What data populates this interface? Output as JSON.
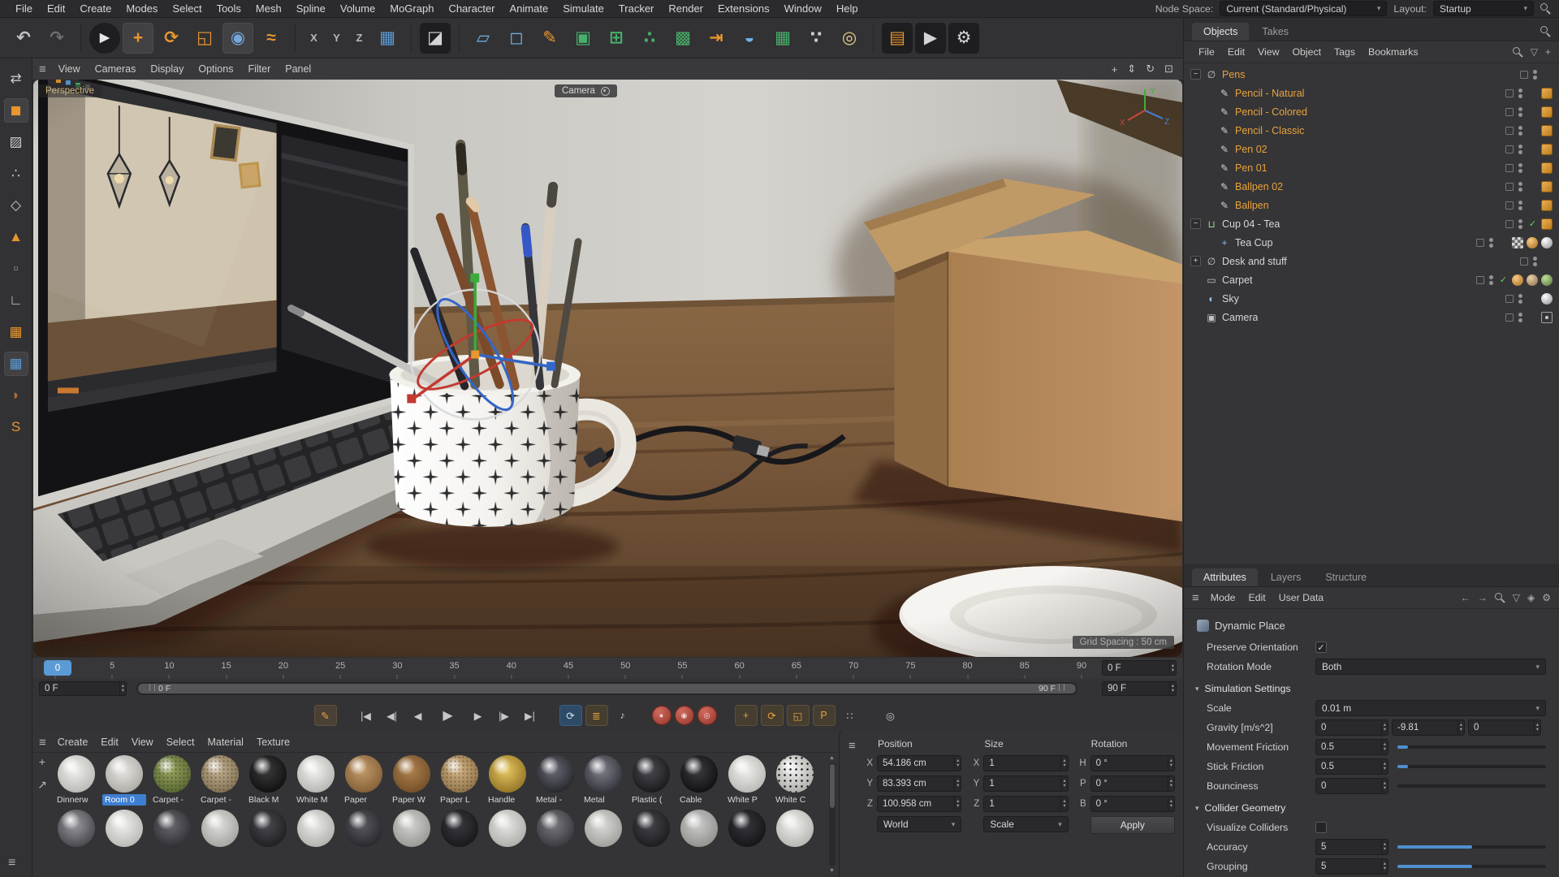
{
  "colors": {
    "accent_orange": "#e8962e",
    "selected_text": "#e8a23c",
    "accent_blue": "#5b9bd5",
    "selection_bg": "#3f7fd2",
    "ui_dark": "#333335"
  },
  "icons": {
    "burger": "≡",
    "chevron": "▾",
    "spin_up": "▴",
    "spin_down": "▾",
    "tick_up": "▲",
    "tick_down": "▼",
    "check": "✓",
    "filter": "▽",
    "back": "←",
    "forward": "→",
    "up": "↑",
    "plus": "+",
    "arrow_ne": "↗",
    "gear": "⚙",
    "lock": "◈",
    "dolly": "⇕",
    "orbit": "↻",
    "maximize": "⊡",
    "pan": "+",
    "section_open": "▾"
  },
  "menu_bar": {
    "items": [
      "File",
      "Edit",
      "Create",
      "Modes",
      "Select",
      "Tools",
      "Mesh",
      "Spline",
      "Volume",
      "MoGraph",
      "Character",
      "Animate",
      "Simulate",
      "Tracker",
      "Render",
      "Extensions",
      "Window",
      "Help"
    ],
    "node_space_label": "Node Space:",
    "node_space_value": "Current (Standard/Physical)",
    "layout_label": "Layout:",
    "layout_value": "Startup"
  },
  "toolbar": {
    "buttons": [
      {
        "name": "undo-icon",
        "glyph": "↶",
        "color": "#c2c2c4"
      },
      {
        "name": "redo-icon",
        "glyph": "↷",
        "color": "#6e6e72"
      },
      {
        "sep": true
      },
      {
        "name": "live-selection-tool",
        "glyph": "►",
        "color": "#e6e6e8",
        "dark": true,
        "round": true
      },
      {
        "name": "move-tool",
        "glyph": "+",
        "color": "#e8962e",
        "active": true
      },
      {
        "name": "rotate-tool",
        "glyph": "⟳",
        "color": "#e8962e"
      },
      {
        "name": "scale-tool",
        "glyph": "◱",
        "color": "#e8962e"
      },
      {
        "name": "dynamic-place-tool",
        "glyph": "◉",
        "color": "#74a8dc",
        "active": true
      },
      {
        "name": "simulate-tool",
        "glyph": "≈",
        "color": "#e8962e"
      },
      {
        "sep": true
      },
      {
        "name": "axis-lock-x-button",
        "glyph": "X",
        "color": "#b8b8ba",
        "small": true
      },
      {
        "name": "axis-lock-y-button",
        "glyph": "Y",
        "color": "#b8b8ba",
        "small": true
      },
      {
        "name": "axis-lock-z-button",
        "glyph": "Z",
        "color": "#b8b8ba",
        "small": true
      },
      {
        "name": "workplane-button",
        "glyph": "▦",
        "color": "#5b9bd5"
      },
      {
        "sep": true
      },
      {
        "name": "render-view-button",
        "glyph": "◪",
        "color": "#d4d4d6",
        "dark": true
      },
      {
        "sep": true
      },
      {
        "name": "floor-object-button",
        "glyph": "▱",
        "color": "#6fb3e8"
      },
      {
        "name": "cube-primitive-button",
        "glyph": "◻",
        "color": "#6fb3e8"
      },
      {
        "name": "pen-spline-button",
        "glyph": "✎",
        "color": "#e8962e"
      },
      {
        "name": "cloner-object-button",
        "glyph": "▣",
        "color": "#47b06a"
      },
      {
        "name": "symmetry-object-button",
        "glyph": "⊞",
        "color": "#47b06a"
      },
      {
        "name": "array-object-button",
        "glyph": "∴",
        "color": "#47b06a"
      },
      {
        "name": "fracture-object-button",
        "glyph": "▩",
        "color": "#47b06a"
      },
      {
        "name": "measure-object-button",
        "glyph": "⇥",
        "color": "#e8962e"
      },
      {
        "name": "cloth-object-button",
        "glyph": "◒",
        "color": "#6fb3e8"
      },
      {
        "name": "plane-object-button",
        "glyph": "▦",
        "color": "#47b06a"
      },
      {
        "name": "particles-object-button",
        "glyph": "∵",
        "color": "#d0d0d2"
      },
      {
        "name": "light-object-button",
        "glyph": "◎",
        "color": "#e8d08a"
      },
      {
        "sep": true
      },
      {
        "name": "nodes-palette-button",
        "glyph": "▤",
        "color": "#e8962e",
        "dark": true
      },
      {
        "name": "render-play-button",
        "glyph": "▶",
        "color": "#d4d4d6",
        "dark": true
      },
      {
        "name": "render-settings-button",
        "glyph": "⚙",
        "color": "#d4d4d6",
        "dark": true
      }
    ]
  },
  "sidebar": {
    "buttons": [
      {
        "name": "make-editable-button",
        "glyph": "⇄",
        "color": "#c8c8ca"
      },
      {
        "name": "model-mode-button",
        "glyph": "◼",
        "color": "#e8962e",
        "active": true
      },
      {
        "name": "texture-mode-button",
        "glyph": "▨",
        "color": "#c8c8ca"
      },
      {
        "name": "points-mode-button",
        "glyph": "∴",
        "color": "#c8c8ca"
      },
      {
        "name": "edges-mode-button",
        "glyph": "◇",
        "color": "#c8c8ca"
      },
      {
        "name": "polygons-mode-button",
        "glyph": "▲",
        "color": "#e8962e"
      },
      {
        "name": "tweak-mode-button",
        "glyph": "▫",
        "color": "#9a9a9c"
      },
      {
        "name": "enable-axis-button",
        "glyph": "∟",
        "color": "#c8c8ca"
      },
      {
        "name": "workplane-mode-button",
        "glyph": "▦",
        "color": "#e8962e"
      },
      {
        "name": "snap-settings-button",
        "glyph": "▦",
        "color": "#5b9bd5",
        "active": true
      },
      {
        "name": "paint-tool-button",
        "glyph": "◗",
        "color": "#b06a3a"
      },
      {
        "name": "substance-button",
        "glyph": "S",
        "color": "#e8962e"
      }
    ]
  },
  "viewport": {
    "menu": [
      "View",
      "Cameras",
      "Display",
      "Options",
      "Filter",
      "Panel"
    ],
    "right_buttons": [
      {
        "name": "camera-pan-icon",
        "glyph": "+"
      },
      {
        "name": "camera-dolly-icon",
        "glyph": "⇕"
      },
      {
        "name": "camera-orbit-icon",
        "glyph": "↻"
      },
      {
        "name": "toggle-view-icon",
        "glyph": "⊡"
      }
    ],
    "view_label": "Perspective",
    "camera_badge": "Camera",
    "grid_spacing_label": "Grid Spacing : 50 cm",
    "axis_labels": {
      "x": "X",
      "y": "Y",
      "z": "Z"
    }
  },
  "object_manager": {
    "tabs": [
      {
        "label": "Objects",
        "active": true
      },
      {
        "label": "Takes",
        "active": false
      }
    ],
    "menu": [
      "File",
      "Edit",
      "View",
      "Object",
      "Tags",
      "Bookmarks"
    ],
    "right_icons": [
      {
        "name": "search-icon",
        "glyph": "css-mag"
      },
      {
        "name": "filter-icon",
        "glyph": "▽"
      },
      {
        "name": "bookmark-add-icon",
        "glyph": "+"
      }
    ],
    "icon_map": {
      "null": {
        "glyph": "∅",
        "color": "#c2c2c4"
      },
      "pencil": {
        "glyph": "✎",
        "color": "#d2d2d4"
      },
      "cup": {
        "glyph": "⊔",
        "color": "#9fd49f"
      },
      "axis": {
        "glyph": "+",
        "color": "#8fb8e8"
      },
      "plane": {
        "glyph": "▭",
        "color": "#c2c2c4"
      },
      "sky": {
        "glyph": "◐",
        "color": "#9ec7e8"
      },
      "camera": {
        "glyph": "▣",
        "color": "#c2c2c4"
      }
    },
    "tree": [
      {
        "label": "Pens",
        "depth": 0,
        "icon": "null",
        "selected": true,
        "expander": "open",
        "check": false,
        "tags": []
      },
      {
        "label": "Pencil - Natural",
        "depth": 1,
        "icon": "pencil",
        "selected": true,
        "expander": "none",
        "check": false,
        "tags": [
          "mat"
        ]
      },
      {
        "label": "Pencil - Colored",
        "depth": 1,
        "icon": "pencil",
        "selected": true,
        "expander": "none",
        "check": false,
        "tags": [
          "mat"
        ]
      },
      {
        "label": "Pencil - Classic",
        "depth": 1,
        "icon": "pencil",
        "selected": true,
        "expander": "none",
        "check": false,
        "tags": [
          "mat"
        ]
      },
      {
        "label": "Pen 02",
        "depth": 1,
        "icon": "pencil",
        "selected": true,
        "expander": "none",
        "check": false,
        "tags": [
          "mat"
        ]
      },
      {
        "label": "Pen 01",
        "depth": 1,
        "icon": "pencil",
        "selected": true,
        "expander": "none",
        "check": false,
        "tags": [
          "mat"
        ]
      },
      {
        "label": "Ballpen 02",
        "depth": 1,
        "icon": "pencil",
        "selected": true,
        "expander": "none",
        "check": false,
        "tags": [
          "mat"
        ]
      },
      {
        "label": "Ballpen",
        "depth": 1,
        "icon": "pencil",
        "selected": true,
        "expander": "none",
        "check": false,
        "tags": [
          "mat"
        ]
      },
      {
        "label": "Cup 04 - Tea",
        "depth": 0,
        "icon": "cup",
        "selected": false,
        "expander": "open",
        "check": true,
        "tags": [
          "mat"
        ]
      },
      {
        "label": "Tea Cup",
        "depth": 1,
        "icon": "axis",
        "selected": false,
        "expander": "none",
        "check": false,
        "tags": [
          "checker",
          "dot-orange",
          "sphere-gray"
        ]
      },
      {
        "label": "Desk and stuff",
        "depth": 0,
        "icon": "null",
        "selected": false,
        "expander": "closed",
        "check": false,
        "tags": []
      },
      {
        "label": "Carpet",
        "depth": 0,
        "icon": "plane",
        "selected": false,
        "expander": "none",
        "check": true,
        "tags": [
          "dot-orange",
          "sphere-tan",
          "sphere-green"
        ]
      },
      {
        "label": "Sky",
        "depth": 0,
        "icon": "sky",
        "selected": false,
        "expander": "none",
        "check": false,
        "tags": [
          "sphere-gray"
        ]
      },
      {
        "label": "Camera",
        "depth": 0,
        "icon": "camera",
        "selected": false,
        "expander": "none",
        "check": false,
        "tags": [
          "target"
        ]
      }
    ]
  },
  "attributes": {
    "tabs": [
      {
        "label": "Attributes",
        "active": true
      },
      {
        "label": "Layers",
        "active": false
      },
      {
        "label": "Structure",
        "active": false
      }
    ],
    "menu": [
      "Mode",
      "Edit",
      "User Data"
    ],
    "right_icons": [
      {
        "name": "history-back-icon",
        "glyph": "←"
      },
      {
        "name": "history-forward-icon",
        "glyph": "→"
      },
      {
        "name": "search-icon",
        "glyph": "css-mag"
      },
      {
        "name": "filter-icon",
        "glyph": "▽"
      },
      {
        "name": "lock-icon",
        "glyph": "◈"
      },
      {
        "name": "settings-gear-icon",
        "glyph": "⚙"
      }
    ],
    "object_title": "Dynamic Place",
    "rows": [
      {
        "type": "check",
        "label": "Preserve Orientation",
        "checked": true
      },
      {
        "type": "dropdown",
        "label": "Rotation Mode",
        "value": "Both"
      },
      {
        "type": "section",
        "label": "Simulation Settings"
      },
      {
        "type": "dropdown",
        "label": "Scale",
        "value": "0.01 m"
      },
      {
        "type": "triple",
        "label": "Gravity [m/s^2]",
        "values": [
          "0",
          "-9.81",
          "0"
        ]
      },
      {
        "type": "slider",
        "label": "Movement Friction",
        "value": "0.5",
        "fill": 7
      },
      {
        "type": "slider",
        "label": "Stick Friction",
        "value": "0.5",
        "fill": 7
      },
      {
        "type": "slider",
        "label": "Bounciness",
        "value": "0",
        "fill": 0
      },
      {
        "type": "section",
        "label": "Collider Geometry"
      },
      {
        "type": "check",
        "label": "Visualize Colliders",
        "checked": false
      },
      {
        "type": "slider",
        "label": "Accuracy",
        "value": "5",
        "fill": 50
      },
      {
        "type": "slider",
        "label": "Grouping",
        "value": "5",
        "fill": 50
      }
    ]
  },
  "timeline": {
    "ticks": [
      "0",
      "5",
      "10",
      "15",
      "20",
      "25",
      "30",
      "35",
      "40",
      "45",
      "50",
      "55",
      "60",
      "65",
      "70",
      "75",
      "80",
      "85",
      "90"
    ],
    "playhead": "0",
    "current_field": "0 F",
    "range_start_field": "0 F",
    "range_end_field": "90 F",
    "bar_start_label": "0 F",
    "bar_end_label": "90 F"
  },
  "playback": {
    "buttons": [
      {
        "name": "animation-palette-button",
        "glyph": "✎",
        "kind": "obg"
      },
      {
        "gap": true
      },
      {
        "name": "go-to-start-button",
        "glyph": "|◀"
      },
      {
        "name": "previous-key-button",
        "glyph": "◀|"
      },
      {
        "name": "previous-frame-button",
        "glyph": "◀"
      },
      {
        "name": "play-button",
        "glyph": "▶",
        "kind": "big"
      },
      {
        "name": "next-frame-button",
        "glyph": "▶"
      },
      {
        "name": "next-key-button",
        "glyph": "|▶"
      },
      {
        "name": "go-to-end-button",
        "glyph": "▶|"
      },
      {
        "gap": true
      },
      {
        "name": "loop-mode-button",
        "glyph": "⟳",
        "kind": "blue"
      },
      {
        "name": "keyframe-track-button",
        "glyph": "≣",
        "kind": "orange"
      },
      {
        "name": "sound-mute-button",
        "glyph": "♪"
      },
      {
        "gap": true
      },
      {
        "name": "record-keyframe-button",
        "glyph": "●",
        "kind": "red"
      },
      {
        "name": "autokey-toggle-button",
        "glyph": "◉",
        "kind": "red"
      },
      {
        "name": "keyframe-selection-button",
        "glyph": "◎",
        "kind": "red"
      },
      {
        "gap": true
      },
      {
        "name": "record-position-button",
        "glyph": "+",
        "kind": "orange"
      },
      {
        "name": "record-rotation-button",
        "glyph": "⟳",
        "kind": "orange"
      },
      {
        "name": "record-scale-button",
        "glyph": "◱",
        "kind": "orange"
      },
      {
        "name": "record-parameter-button",
        "glyph": "P",
        "kind": "orange"
      },
      {
        "name": "record-pla-button",
        "glyph": "∷"
      },
      {
        "gap": true
      },
      {
        "name": "solo-animation-button",
        "glyph": "◎"
      }
    ]
  },
  "materials": {
    "menu": [
      "Create",
      "Edit",
      "View",
      "Select",
      "Material",
      "Texture"
    ],
    "items": [
      {
        "name": "Dinnerw",
        "c1": "#f0f0ee",
        "c2": "#b0b0ac"
      },
      {
        "name": "Room 0",
        "c1": "#e8e6e2",
        "c2": "#a4a29c",
        "selected": true
      },
      {
        "name": "Carpet -",
        "c1": "#97a45e",
        "c2": "#50602e",
        "kind": "speckle"
      },
      {
        "name": "Carpet -",
        "c1": "#c2b190",
        "c2": "#7a6a4c",
        "kind": "speckle"
      },
      {
        "name": "Black M",
        "c1": "#3c3c3e",
        "c2": "#0a0a0a"
      },
      {
        "name": "White M",
        "c1": "#f2f2f0",
        "c2": "#acaca8"
      },
      {
        "name": "Paper",
        "c1": "#c49a68",
        "c2": "#7a5830"
      },
      {
        "name": "Paper W",
        "c1": "#b0824e",
        "c2": "#6a4822"
      },
      {
        "name": "Paper L",
        "c1": "#d4b484",
        "c2": "#866a42",
        "kind": "speckle"
      },
      {
        "name": "Handle",
        "c1": "#e8c860",
        "c2": "#86681e"
      },
      {
        "name": "Metal -",
        "c1": "#6a6a74",
        "c2": "#1c1c22"
      },
      {
        "name": "Metal",
        "c1": "#80808a",
        "c2": "#282830"
      },
      {
        "name": "Plastic (",
        "c1": "#4a4a50",
        "c2": "#121216"
      },
      {
        "name": "Cable",
        "c1": "#3c3c40",
        "c2": "#0a0a0c"
      },
      {
        "name": "White P",
        "c1": "#f0f0ee",
        "c2": "#b0b0ac"
      },
      {
        "name": "White C",
        "c1": "#ececea",
        "c2": "#a4a4a0",
        "kind": "dots"
      }
    ],
    "row2": [
      [
        "#9a9aa0",
        "#3a3a40"
      ],
      [
        "#f0f0ee",
        "#b0b0ac"
      ],
      [
        "#6a6a70",
        "#26262c"
      ],
      [
        "#e0e0de",
        "#9a9a96"
      ],
      [
        "#4a4a50",
        "#18181c"
      ],
      [
        "#ececea",
        "#a8a8a4"
      ],
      [
        "#5a5a60",
        "#202026"
      ],
      [
        "#d4d4d2",
        "#8e8e8a"
      ],
      [
        "#3a3a40",
        "#121216"
      ],
      [
        "#e8e8e6",
        "#a4a4a0"
      ],
      [
        "#7a7a80",
        "#2e2e34"
      ],
      [
        "#dcdcda",
        "#969692"
      ],
      [
        "#44444a",
        "#16161a"
      ],
      [
        "#cccccc",
        "#888884"
      ],
      [
        "#36363c",
        "#101014"
      ],
      [
        "#f0f0ee",
        "#acaca8"
      ]
    ]
  },
  "coordinates": {
    "groups": [
      {
        "header": "Position",
        "rows": [
          [
            "X",
            "54.186 cm"
          ],
          [
            "Y",
            "83.393 cm"
          ],
          [
            "Z",
            "100.958 cm"
          ]
        ],
        "footer": {
          "type": "dropdown",
          "value": "World",
          "name": "coordinate-space-dropdown"
        }
      },
      {
        "header": "Size",
        "rows": [
          [
            "X",
            "1"
          ],
          [
            "Y",
            "1"
          ],
          [
            "Z",
            "1"
          ]
        ],
        "footer": {
          "type": "dropdown",
          "value": "Scale",
          "name": "size-mode-dropdown"
        }
      },
      {
        "header": "Rotation",
        "rows": [
          [
            "H",
            "0 °"
          ],
          [
            "P",
            "0 °"
          ],
          [
            "B",
            "0 °"
          ]
        ],
        "footer": {
          "type": "button",
          "value": "Apply",
          "name": "apply-button"
        }
      }
    ]
  }
}
